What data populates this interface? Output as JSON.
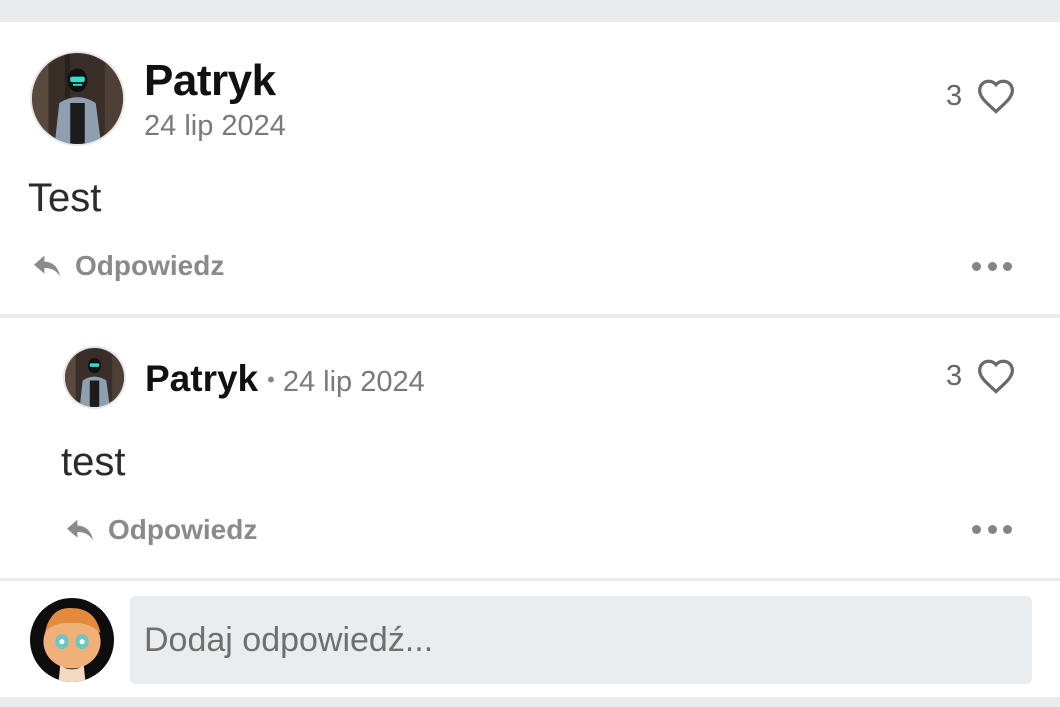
{
  "comment": {
    "author": "Patryk",
    "date": "24 lip 2024",
    "text": "Test",
    "likes": "3",
    "reply_label": "Odpowiedz"
  },
  "reply": {
    "author": "Patryk",
    "separator": "•",
    "date": "24 lip 2024",
    "text": "test",
    "likes": "3",
    "reply_label": "Odpowiedz"
  },
  "composer": {
    "placeholder": "Dodaj odpowiedź..."
  },
  "icons": {
    "like": "heart-outline-icon",
    "reply": "reply-arrow-icon",
    "more": "more-horizontal-icon"
  },
  "colors": {
    "background": "#e9ecee",
    "card": "#ffffff",
    "muted_text": "#7a7a7a",
    "input_bg": "#eaedef"
  }
}
